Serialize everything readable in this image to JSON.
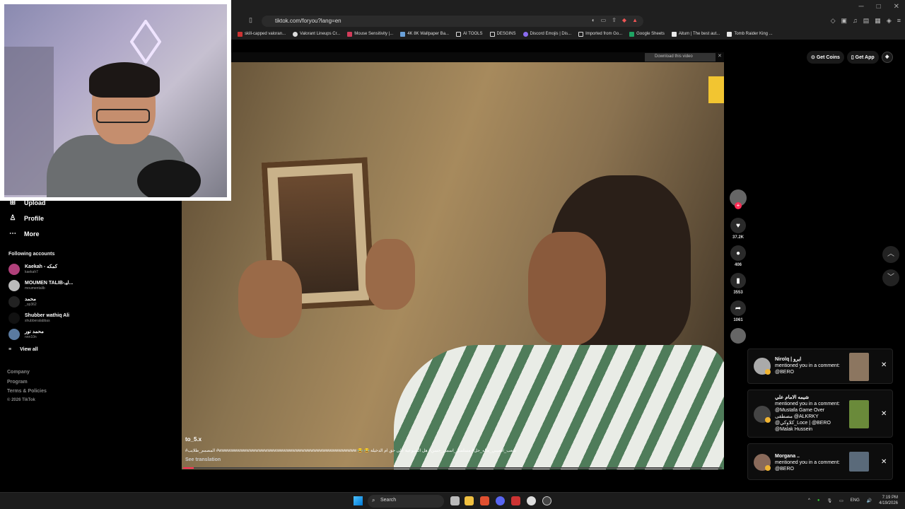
{
  "browser": {
    "url": "tiktok.com/foryou?lang=en",
    "bookmarks": [
      "skill-capped valoran...",
      "Valorant Lineups Cr...",
      "Mouse Sensitivity |...",
      "4K 8K Wallpaper Ba...",
      "AI TOOLS",
      "DESGINS",
      "Discord Emojis | Dis...",
      "Imported from Go...",
      "Google Sheets",
      "Aitum | The best aut...",
      "Tomb Raider King ..."
    ]
  },
  "sidebar": {
    "nav": [
      {
        "label": "Upload",
        "icon": "upload-icon"
      },
      {
        "label": "Profile",
        "icon": "profile-icon"
      },
      {
        "label": "More",
        "icon": "more-icon"
      }
    ],
    "following_title": "Following accounts",
    "accounts": [
      {
        "name": "Kaekah - كمكه",
        "handle": "kaekah7"
      },
      {
        "name": "MOUMEN TALIB-ليـ...",
        "handle": "moumentalib"
      },
      {
        "name": "محمد",
        "handle": "_op362"
      },
      {
        "name": "Shubber wathiq Ali",
        "handle": "shubberalabbas"
      },
      {
        "name": "محمد نور",
        "handle": "nnn10n"
      }
    ],
    "view_all": "View all",
    "footer": [
      "Company",
      "Program",
      "Terms & Policies",
      "© 2026 TikTok"
    ]
  },
  "video": {
    "download_label": "Download this video",
    "username": "to_5.x",
    "caption": "#المصمم_طلايب #wwwwwwwwwwwwwwwwwwwwwwwwwwwwwwwwwwwwwwwwwwwww 😂 😂 شعب_الصيني_ماله_حل# مسلسل_اسمي_حسن# هل الشيوعية على حق ام الدخيلة",
    "see_translation": "See translation",
    "progress": 0.02
  },
  "actions": {
    "likes": "37.2K",
    "comments": "406",
    "saves": "3553",
    "shares": "1061"
  },
  "header": {
    "get_coins": "Get Coins",
    "get_app": "Get App"
  },
  "notifications": [
    {
      "name": "Nirolq | ايرو",
      "text": "mentioned you in a comment: @BERO"
    },
    {
      "name": "شيمه الامام علي",
      "text": "mentioned you in a comment: @Mustafa Game Over مصطفى @ALKRKY @كلاوكي_Loce | @BERO @Malak Hussein"
    },
    {
      "name": "Morgana ..",
      "text": "mentioned you in a comment: @BERO"
    }
  ],
  "taskbar": {
    "search": "Search",
    "lang": "ENG",
    "time": "7:19 PM",
    "date": "4/19/2026"
  }
}
